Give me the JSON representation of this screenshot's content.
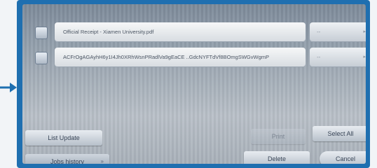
{
  "files": [
    {
      "name": "Official Receipt - Xiamen University.pdf",
      "option": "--"
    },
    {
      "name": "ACFrOgAGAyhH6y1I4Jh0XRhWsnPRadlVa9gEaCE ..GdcNYFTdVf8BOmgSWGvWgmP",
      "option": "--"
    }
  ],
  "buttons": {
    "list_update": "List Update",
    "print": "Print",
    "select_all": "Select All",
    "jobs_history": "Jobs history",
    "delete": "Delete",
    "cancel": "Cancel"
  },
  "colors": {
    "frame": "#1f6fb0",
    "arrow": "#1f6fb0"
  }
}
